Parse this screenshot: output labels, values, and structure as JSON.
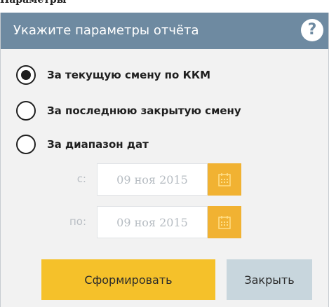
{
  "dialog": {
    "title": "Укажите параметры отчёта",
    "help_icon": "question-circle-icon"
  },
  "options": [
    {
      "label": "За текущую смену по ККМ",
      "selected": true
    },
    {
      "label": "За последнюю закрытую смену",
      "selected": false
    },
    {
      "label": "За диапазон дат",
      "selected": false
    }
  ],
  "date_range": {
    "from_label": "с:",
    "from_value": "09 ноя 2015",
    "to_label": "по:",
    "to_value": "09 ноя 2015",
    "calendar_icon": "calendar-icon"
  },
  "buttons": {
    "submit_label": "Сформировать",
    "close_label": "Закрыть"
  },
  "colors": {
    "titlebar": "#6e8aa1",
    "accent": "#f5c12a",
    "calendar_button": "#f1b232",
    "secondary_button": "#c8d6dd"
  }
}
